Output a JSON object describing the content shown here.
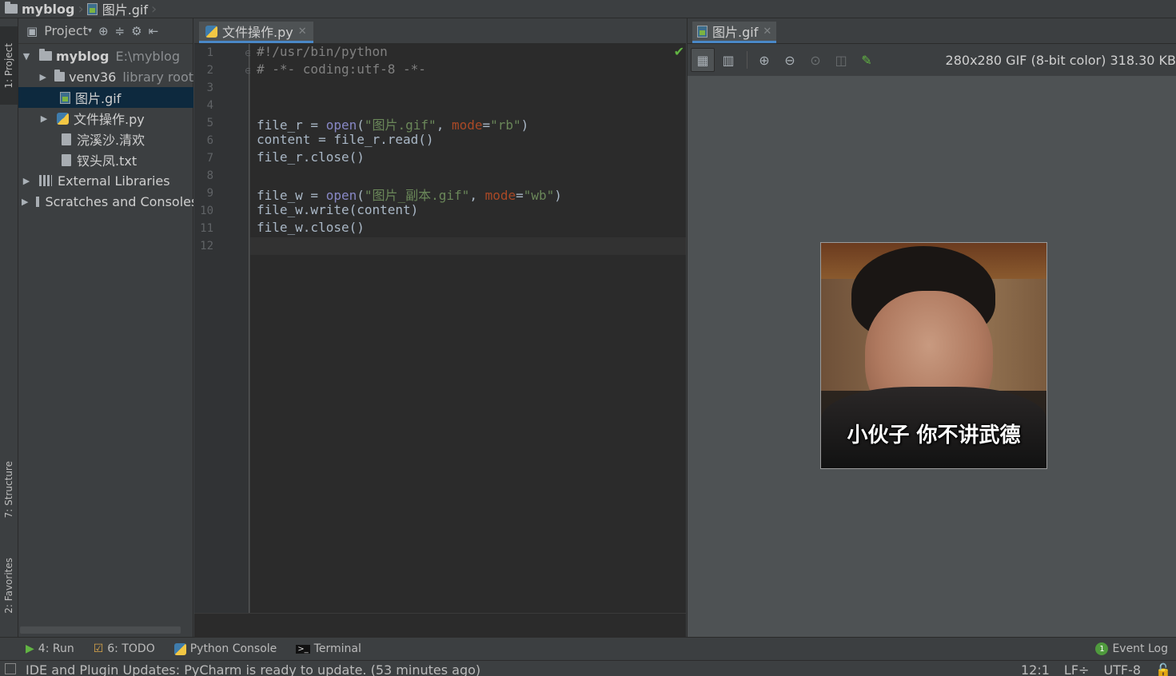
{
  "breadcrumb": {
    "project": "myblog",
    "file": "图片.gif"
  },
  "left_strip": {
    "project_tab": "1: Project",
    "structure_tab": "7: Structure",
    "favorites_tab": "2: Favorites"
  },
  "project_panel": {
    "title": "Project",
    "tree": {
      "root_name": "myblog",
      "root_path": "E:\\myblog",
      "venv_name": "venv36",
      "venv_note": "library root",
      "file_gif": "图片.gif",
      "file_py": "文件操作.py",
      "file_poem1": "浣溪沙.清欢",
      "file_poem2": "钗头凤.txt",
      "external_libraries": "External Libraries",
      "scratches": "Scratches and Consoles"
    }
  },
  "editor": {
    "tab_label": "文件操作.py",
    "line_numbers": [
      "1",
      "2",
      "3",
      "4",
      "5",
      "6",
      "7",
      "8",
      "9",
      "10",
      "11",
      "12"
    ],
    "lines": {
      "l1": "#!/usr/bin/python",
      "l2": "# -*- coding:utf-8 -*-",
      "l5a": "file_r = ",
      "l5b": "open",
      "l5c": "(",
      "l5d": "\"图片.gif\"",
      "l5e": ", ",
      "l5f": "mode",
      "l5g": "=",
      "l5h": "\"rb\"",
      "l5i": ")",
      "l6": "content = file_r.read()",
      "l7": "file_r.close()",
      "l9a": "file_w = ",
      "l9b": "open",
      "l9c": "(",
      "l9d": "\"图片_副本.gif\"",
      "l9e": ", ",
      "l9f": "mode",
      "l9g": "=",
      "l9h": "\"wb\"",
      "l9i": ")",
      "l10": "file_w.write(content)",
      "l11": "file_w.close()"
    }
  },
  "image_viewer": {
    "tab_label": "图片.gif",
    "info": "280x280 GIF (8-bit color) 318.30 KB",
    "image_caption": "小伙子 你不讲武德"
  },
  "bottom_tools": {
    "run": "4: Run",
    "todo": "6: TODO",
    "python_console": "Python Console",
    "terminal": "Terminal",
    "event_log": "Event Log"
  },
  "status": {
    "message": "IDE and Plugin Updates: PyCharm is ready to update. (53 minutes ago)",
    "position": "12:1",
    "line_sep": "LF÷",
    "encoding": "UTF-8"
  },
  "colors": {
    "accent": "#4a88c7",
    "selection": "#0d293e",
    "editor_bg": "#2b2b2b",
    "string": "#6a8759",
    "builtin": "#8888c6",
    "param": "#aa4926",
    "ok": "#62b543"
  }
}
